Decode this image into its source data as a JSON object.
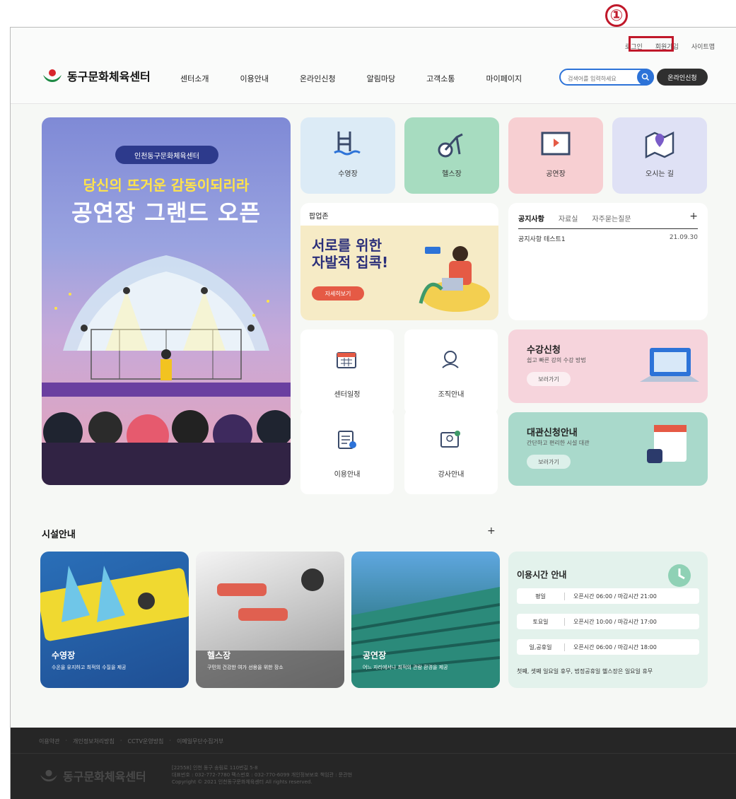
{
  "annotation": {
    "number": "①"
  },
  "util_nav": {
    "login": "로그인",
    "signup": "회원가입",
    "sitemap": "사이트맵"
  },
  "brand": {
    "name": "동구문화체육센터"
  },
  "gnb": [
    "센터소개",
    "이용안내",
    "온라인신청",
    "알림마당",
    "고객소통",
    "마이페이지"
  ],
  "search": {
    "placeholder": "검색어를 입력하세요"
  },
  "online_apply_button": "온라인신청",
  "hero": {
    "tag": "인천동구문화체육센터",
    "subtitle": "당신의 뜨거운 감동이되리라",
    "title": "공연장 그랜드 오픈"
  },
  "quick_tiles": [
    {
      "label": "수영장",
      "icon": "swimming-pool-icon",
      "color": "#dcebf6"
    },
    {
      "label": "헬스장",
      "icon": "exercise-bike-icon",
      "color": "#a7dcc0"
    },
    {
      "label": "공연장",
      "icon": "stage-icon",
      "color": "#f7cfd2"
    },
    {
      "label": "오시는 길",
      "icon": "map-pin-icon",
      "color": "#dfe1f5"
    }
  ],
  "popup_zone": {
    "label": "팝업존",
    "headline_line1": "서로를 위한",
    "headline_line2": "자발적 집콕!",
    "button": "자세히보기"
  },
  "notice": {
    "tabs": [
      "공지사항",
      "자료실",
      "자주묻는질문"
    ],
    "more": "+",
    "items": [
      {
        "title": "공지사항 테스트1",
        "date": "21.09.30"
      }
    ]
  },
  "cards": {
    "course": {
      "title": "수강신청",
      "desc": "쉽고 빠른 강의 수강 방법",
      "button": "보러가기",
      "color": "#f6d4dc"
    },
    "rental": {
      "title": "대관신청안내",
      "desc": "간단하고 편리한 시설 대관",
      "button": "보러가기",
      "color": "#a9d9cb"
    }
  },
  "small_tiles": [
    {
      "label": "센터일정",
      "icon": "calendar-icon"
    },
    {
      "label": "조직안내",
      "icon": "organization-icon"
    },
    {
      "label": "이용안내",
      "icon": "clipboard-icon"
    },
    {
      "label": "강사안내",
      "icon": "instructor-icon"
    }
  ],
  "facility": {
    "title": "시설안내",
    "more": "+",
    "items": [
      {
        "name": "수영장",
        "desc": "수온을 유지하고 최적의 수질을 제공"
      },
      {
        "name": "헬스장",
        "desc": "구민의 건강한 여가 선용을 위한 장소"
      },
      {
        "name": "공연장",
        "desc": "어느 자리에서나 최적의 관람 환경을 제공"
      }
    ]
  },
  "hours": {
    "title": "이용시간 안내",
    "rows": [
      {
        "day": "평일",
        "time": "오픈시간 06:00 / 마감시간 21:00"
      },
      {
        "day": "토요일",
        "time": "오픈시간 10:00 / 마감시간 17:00"
      },
      {
        "day": "일,공휴일",
        "time": "오픈시간 06:00 / 마감시간 18:00"
      }
    ],
    "note": "첫째, 셋째 일요일 휴무, 법정공휴일 헬스장은 일요일 휴무"
  },
  "footer": {
    "links": [
      "이용약관",
      "개인정보처리방침",
      "CCTV운영방침",
      "이메일무단수집거부"
    ],
    "separator": "·",
    "logo": "동구문화체육센터",
    "address": "[22558] 인천 동구 송림로 110번길 5-8",
    "contact": "대표번호 : 032-772-7780    팩스번호 : 032-770-6099    개인정보보호 책임관 : 문관현",
    "copyright": "Copyright © 2021 인천동구문화체육센터 All rights reserved."
  }
}
